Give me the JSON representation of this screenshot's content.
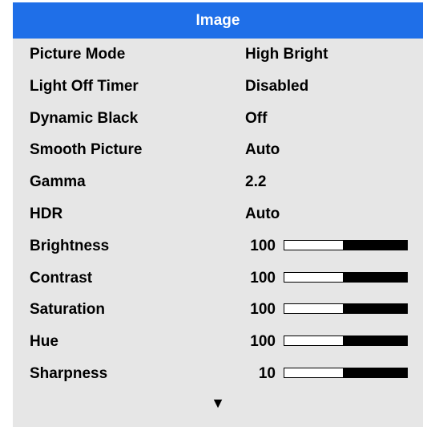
{
  "menu": {
    "title": "Image",
    "items": [
      {
        "label": "Picture Mode",
        "value": "High Bright"
      },
      {
        "label": "Light Off Timer",
        "value": "Disabled"
      },
      {
        "label": "Dynamic Black",
        "value": "Off"
      },
      {
        "label": "Smooth Picture",
        "value": "Auto"
      },
      {
        "label": "Gamma",
        "value": "2.2"
      },
      {
        "label": "HDR",
        "value": "Auto"
      }
    ],
    "sliders": [
      {
        "label": "Brightness",
        "value": "100",
        "fill_fraction": 0.52
      },
      {
        "label": "Contrast",
        "value": "100",
        "fill_fraction": 0.52
      },
      {
        "label": "Saturation",
        "value": "100",
        "fill_fraction": 0.52
      },
      {
        "label": "Hue",
        "value": "100",
        "fill_fraction": 0.52
      },
      {
        "label": "Sharpness",
        "value": "10",
        "fill_fraction": 0.52
      }
    ],
    "more_indicator": "▼"
  },
  "colors": {
    "title_bar": "#1f6fe8",
    "panel": "#e6e6e6"
  }
}
